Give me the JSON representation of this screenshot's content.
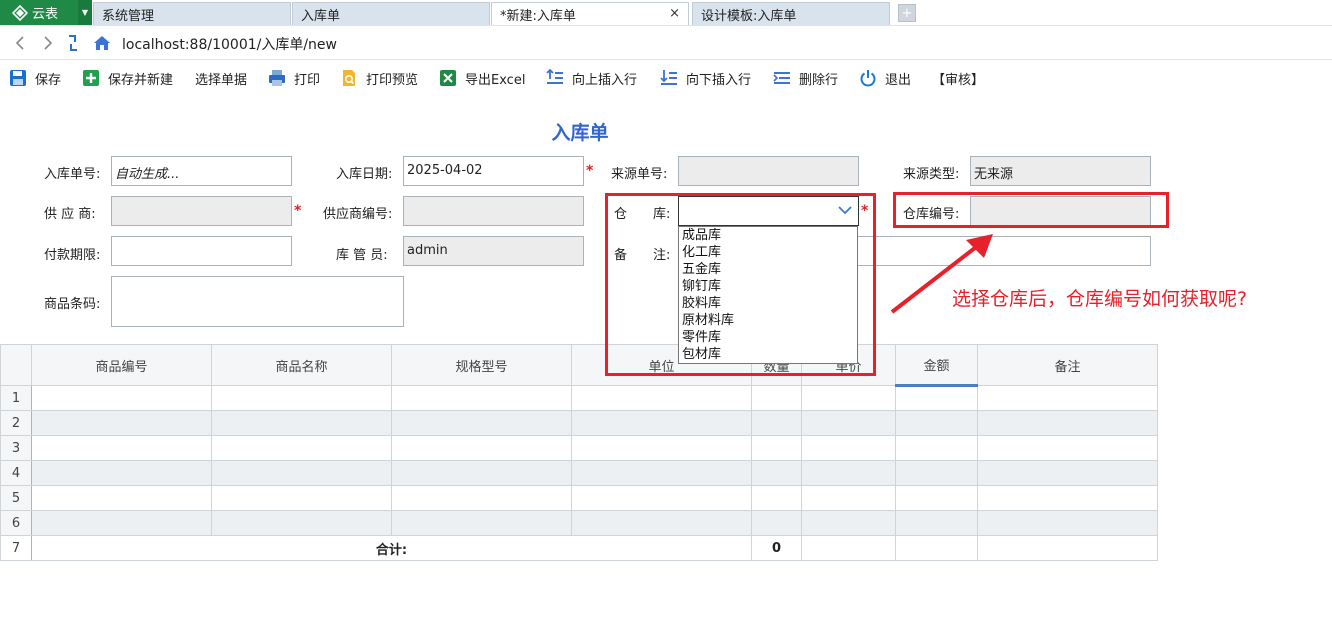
{
  "app": {
    "name": "云表",
    "icon": "cloud-table-logo-icon"
  },
  "tabs": [
    {
      "label": "系统管理",
      "active": false
    },
    {
      "label": "入库单",
      "active": false
    },
    {
      "label": "*新建:入库单",
      "active": true,
      "close": "×"
    },
    {
      "label": "设计模板:入库单",
      "active": false
    }
  ],
  "tab_add": "+",
  "address": {
    "url": "localhost:88/10001/入库单/new"
  },
  "toolbar": [
    {
      "label": "保存",
      "icon": "save-icon"
    },
    {
      "label": "保存并新建",
      "icon": "save-new-icon"
    },
    {
      "label": "选择单据",
      "icon": ""
    },
    {
      "label": "打印",
      "icon": "print-icon"
    },
    {
      "label": "打印预览",
      "icon": "print-preview-icon"
    },
    {
      "label": "导出Excel",
      "icon": "excel-icon"
    },
    {
      "label": "向上插入行",
      "icon": "insert-row-above-icon"
    },
    {
      "label": "向下插入行",
      "icon": "insert-row-below-icon"
    },
    {
      "label": "删除行",
      "icon": "delete-row-icon"
    },
    {
      "label": "退出",
      "icon": "power-icon"
    },
    {
      "label": "【审核】",
      "icon": ""
    }
  ],
  "form": {
    "title": "入库单",
    "order_no": {
      "label": "入库单号:",
      "value": "自动生成..."
    },
    "date": {
      "label": "入库日期:",
      "value": "2025-04-02"
    },
    "source_no": {
      "label": "来源单号:",
      "value": ""
    },
    "source_type": {
      "label": "来源类型:",
      "value": "无来源"
    },
    "supplier": {
      "label": "供 应 商:",
      "value": ""
    },
    "supplier_no": {
      "label": "供应商编号:",
      "value": ""
    },
    "warehouse": {
      "label": "仓　　库:",
      "value": ""
    },
    "warehouse_no": {
      "label": "仓库编号:",
      "value": ""
    },
    "payment_term": {
      "label": "付款期限:",
      "value": ""
    },
    "keeper": {
      "label": "库 管 员:",
      "value": "admin"
    },
    "remark": {
      "label": "备　　注:",
      "value": ""
    },
    "barcode": {
      "label": "商品条码:",
      "value": ""
    },
    "required_mark": "*"
  },
  "warehouse_options": [
    "成品库",
    "化工库",
    "五金库",
    "铆钉库",
    "胶料库",
    "原材料库",
    "零件库",
    "包材库"
  ],
  "grid": {
    "columns": [
      "商品编号",
      "商品名称",
      "规格型号",
      "单位",
      "数量",
      "单价",
      "金额",
      "备注"
    ],
    "row_numbers": [
      "1",
      "2",
      "3",
      "4",
      "5",
      "6",
      "7"
    ],
    "total_label": "合计:",
    "total_qty": "0"
  },
  "annotation": {
    "text": "选择仓库后，仓库编号如何获取呢?",
    "color": "#e8202a"
  }
}
